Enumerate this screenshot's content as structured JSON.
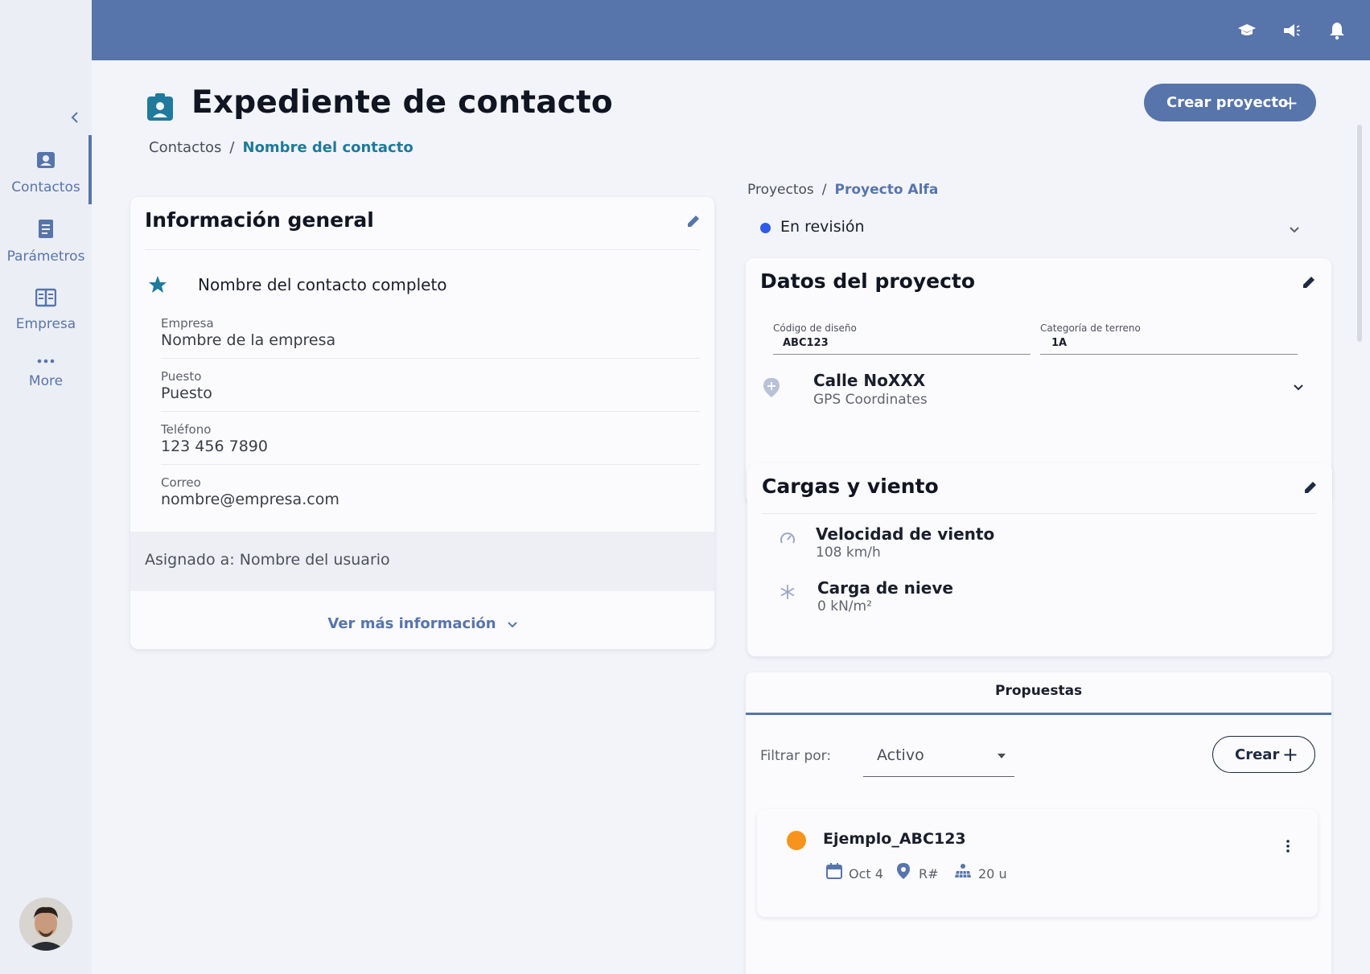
{
  "sidebar": {
    "items": [
      {
        "label": "Contactos"
      },
      {
        "label": "Parámetros"
      },
      {
        "label": "Empresa"
      },
      {
        "label": "More"
      }
    ]
  },
  "page": {
    "title": "Expediente de contacto",
    "create_project_label": "Crear proyecto",
    "breadcrumb": {
      "root": "Contactos",
      "sep": "/",
      "current": "Nombre del contacto"
    }
  },
  "general": {
    "title": "Información general",
    "contact_name": "Nombre del contacto completo",
    "fields": [
      {
        "label": "Empresa",
        "value": "Nombre de la empresa"
      },
      {
        "label": "Puesto",
        "value": "Puesto"
      },
      {
        "label": "Teléfono",
        "value": "123 456 7890"
      },
      {
        "label": "Correo",
        "value": "nombre@empresa.com"
      }
    ],
    "assigned": "Asignado a: Nombre del usuario",
    "more_label": "Ver más información"
  },
  "project": {
    "breadcrumb": {
      "root": "Proyectos",
      "sep": "/",
      "current": "Proyecto Alfa"
    },
    "status": "En revisión",
    "status_color": "#2f5be8"
  },
  "datos": {
    "title": "Datos del proyecto",
    "code_label": "Código de diseño",
    "code_value": "ABC123",
    "terrain_label": "Categoría de terreno",
    "terrain_value": "1A",
    "address": "Calle NoXXX",
    "gps": "GPS Coordinates"
  },
  "cargas": {
    "title": "Cargas y viento",
    "wind_label": "Velocidad de viento",
    "wind_value": "108 km/h",
    "snow_label": "Carga de nieve",
    "snow_value": "0 kN/m²"
  },
  "propuestas": {
    "tab": "Propuestas",
    "filter_label": "Filtrar por:",
    "filter_value": "Activo",
    "create_label": "Crear",
    "items": [
      {
        "name": "Ejemplo_ABC123",
        "date": "Oct 4",
        "ref": "R#",
        "units": "20 u",
        "dot_color": "#f7941d"
      }
    ]
  },
  "colors": {
    "brand": "#5775ab",
    "accent": "#1f7a9c"
  }
}
